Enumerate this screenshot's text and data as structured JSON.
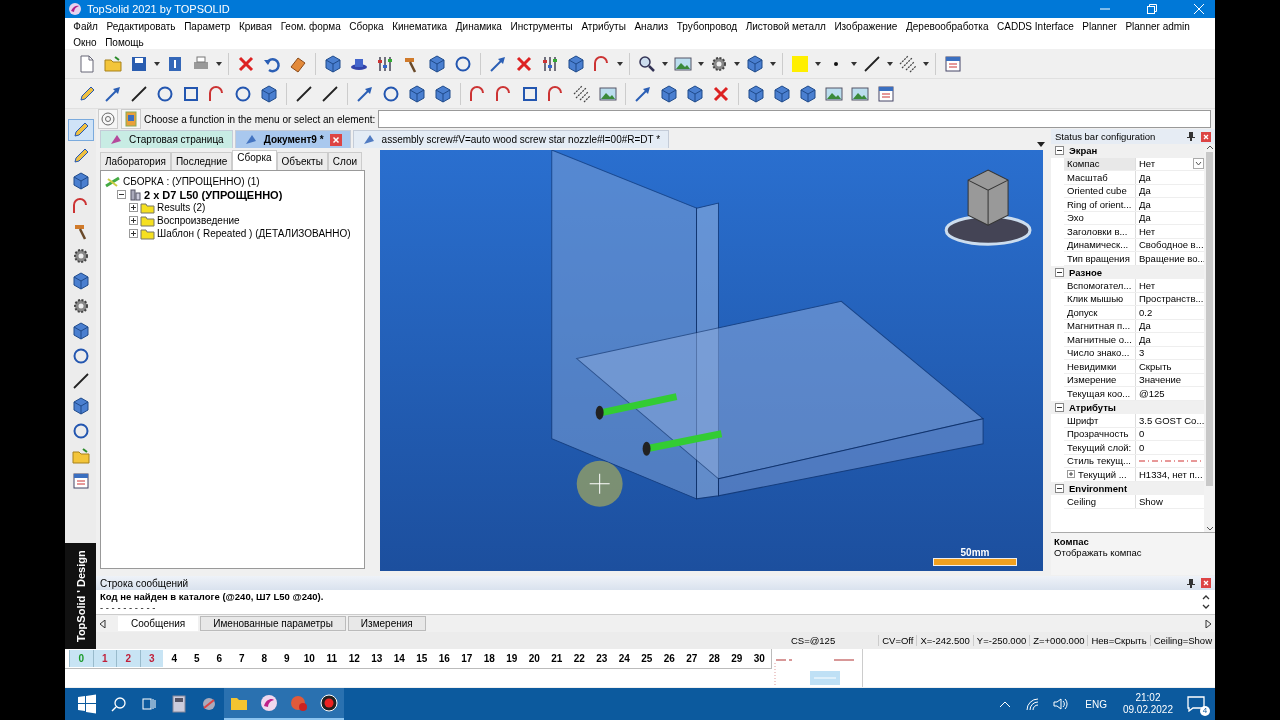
{
  "window": {
    "title": "TopSolid 2021 by TOPSOLID"
  },
  "menu": [
    "Файл",
    "Редактировать",
    "Параметр",
    "Кривая",
    "Геом. форма",
    "Сборка",
    "Кинематика",
    "Динамика",
    "Инструменты",
    "Атрибуты",
    "Анализ",
    "Трубопровод",
    "Листовой металл",
    "Изображение",
    "Деревообработка",
    "CADDS Interface",
    "Planner",
    "Planner admin",
    "Окно",
    "Помощь"
  ],
  "command": {
    "prompt": "Choose a function in the menu or select an element:"
  },
  "doc_tabs": [
    {
      "label": "Стартовая страница",
      "selected": false,
      "closable": false
    },
    {
      "label": "Документ9 *",
      "selected": true,
      "closable": true
    },
    {
      "label": "assembly screw#V=auto wood screw star nozzle#l=00#R=DT *",
      "selected": false,
      "closable": false
    }
  ],
  "panel_tabs": [
    {
      "label": "Лаборатория",
      "selected": false
    },
    {
      "label": "Последние",
      "selected": false
    },
    {
      "label": "Сборка",
      "selected": true
    },
    {
      "label": "Объекты",
      "selected": false
    },
    {
      "label": "Слои",
      "selected": false
    }
  ],
  "tree": [
    {
      "label": "СБОРКА : (УПРОЩЕННО) (1)",
      "bold": false,
      "children": [
        {
          "label": "2 x D7 L50 (УПРОЩЕННО)",
          "bold": true,
          "expanded": true,
          "children": [
            {
              "label": "Results (2)",
              "bold": false,
              "expanded": false
            },
            {
              "label": "Воспроизведение",
              "bold": false,
              "expanded": false
            },
            {
              "label": "Шаблон ( Repeated ) (ДЕТАЛИЗОВАННО)",
              "bold": false,
              "expanded": false
            }
          ]
        }
      ]
    }
  ],
  "viewport": {
    "scale_label": "50mm"
  },
  "properties": {
    "title": "Status bar configuration",
    "groups": [
      {
        "name": "Экран",
        "expanded": true,
        "rows": [
          {
            "kind": "text",
            "name": "Компас",
            "value": "Нет",
            "selected": true
          },
          {
            "kind": "text",
            "name": "Масштаб",
            "value": "Да",
            "selected": false
          },
          {
            "kind": "text",
            "name": "Oriented cube",
            "value": "Да",
            "selected": false
          },
          {
            "kind": "text",
            "name": "Ring of orient...",
            "value": "Да",
            "selected": false
          },
          {
            "kind": "text",
            "name": "Эхо",
            "value": "Да",
            "selected": false
          },
          {
            "kind": "text",
            "name": "Заголовки в...",
            "value": "Нет",
            "selected": false
          },
          {
            "kind": "text",
            "name": "Динамическ...",
            "value": "Свободное в...",
            "selected": false
          },
          {
            "kind": "text",
            "name": "Тип вращения",
            "value": "Вращение во...",
            "selected": false
          }
        ]
      },
      {
        "name": "Разное",
        "expanded": true,
        "rows": [
          {
            "kind": "text",
            "name": "Вспомогател...",
            "value": "Нет",
            "selected": false
          },
          {
            "kind": "text",
            "name": "Клик мышью",
            "value": "Пространств...",
            "selected": false
          },
          {
            "kind": "text",
            "name": "Допуск",
            "value": "0.2",
            "selected": false
          },
          {
            "kind": "text",
            "name": "Магнитная п...",
            "value": "Да",
            "selected": false
          },
          {
            "kind": "text",
            "name": "Магнитные о...",
            "value": "Да",
            "selected": false
          },
          {
            "kind": "text",
            "name": "Число знако...",
            "value": "3",
            "selected": false
          },
          {
            "kind": "text",
            "name": "Невидимки",
            "value": "Скрыть",
            "selected": false
          },
          {
            "kind": "text",
            "name": "Измерение",
            "value": "Значение",
            "selected": false
          },
          {
            "kind": "text",
            "name": "Текущая коо...",
            "value": "@125",
            "selected": false
          }
        ]
      },
      {
        "name": "Атрибуты",
        "expanded": true,
        "rows": [
          {
            "kind": "text",
            "name": "Шрифт",
            "value": "3.5  GOST Co...",
            "selected": false
          },
          {
            "kind": "text",
            "name": "Прозрачность",
            "value": "0",
            "selected": false
          },
          {
            "kind": "text",
            "name": "Текущий слой:",
            "value": "0",
            "selected": false
          },
          {
            "kind": "linestyle",
            "name": "Стиль текущ...",
            "selected": false
          },
          {
            "kind": "text",
            "name": "Текущий ...",
            "value": "H1334, нет п...",
            "selected": false,
            "expanded": false
          }
        ]
      },
      {
        "name": "Environment",
        "expanded": true,
        "rows": [
          {
            "kind": "text",
            "name": "Ceiling",
            "value": "Show",
            "selected": false
          }
        ]
      }
    ],
    "description": {
      "title": "Компас",
      "text": "Отображать компас"
    }
  },
  "messages": {
    "title": "Строка сообщений",
    "lines": [
      "Код не найден в каталоге (@240, Ш7 L50 @240).",
      "- - - - - - - - - -"
    ],
    "tabs": [
      {
        "label": "Сообщения",
        "selected": true
      },
      {
        "label": "Именованные параметры",
        "selected": false
      },
      {
        "label": "Измерения",
        "selected": false
      }
    ]
  },
  "status": [
    "CS=@125",
    "CV=Off",
    "X=-242.500",
    "Y=-250.000",
    "Z=+000.000",
    "Нев=Скрыть",
    "Ceiling=Show"
  ],
  "layers": [
    {
      "label": "0",
      "selected": true,
      "color": "#1a9a2a"
    },
    {
      "label": "1",
      "selected": true,
      "color": "#c0203a"
    },
    {
      "label": "2",
      "selected": true,
      "color": "#c0203a"
    },
    {
      "label": "3",
      "selected": true,
      "color": "#c0203a"
    },
    {
      "label": "4",
      "selected": false,
      "color": "#000000"
    },
    {
      "label": "5",
      "selected": false,
      "color": "#000000"
    },
    {
      "label": "6",
      "selected": false,
      "color": "#000000"
    },
    {
      "label": "7",
      "selected": false,
      "color": "#000000"
    },
    {
      "label": "8",
      "selected": false,
      "color": "#000000"
    },
    {
      "label": "9",
      "selected": false,
      "color": "#000000"
    },
    {
      "label": "10",
      "selected": false,
      "color": "#000000"
    },
    {
      "label": "11",
      "selected": false,
      "color": "#000000"
    },
    {
      "label": "12",
      "selected": false,
      "color": "#000000"
    },
    {
      "label": "13",
      "selected": false,
      "color": "#000000"
    },
    {
      "label": "14",
      "selected": false,
      "color": "#000000"
    },
    {
      "label": "15",
      "selected": false,
      "color": "#000000"
    },
    {
      "label": "16",
      "selected": false,
      "color": "#000000"
    },
    {
      "label": "17",
      "selected": false,
      "color": "#000000"
    },
    {
      "label": "18",
      "selected": false,
      "color": "#000000"
    },
    {
      "label": "19",
      "selected": false,
      "color": "#000000"
    },
    {
      "label": "20",
      "selected": false,
      "color": "#000000"
    },
    {
      "label": "21",
      "selected": false,
      "color": "#000000"
    },
    {
      "label": "22",
      "selected": false,
      "color": "#000000"
    },
    {
      "label": "23",
      "selected": false,
      "color": "#000000"
    },
    {
      "label": "24",
      "selected": false,
      "color": "#000000"
    },
    {
      "label": "25",
      "selected": false,
      "color": "#000000"
    },
    {
      "label": "26",
      "selected": false,
      "color": "#000000"
    },
    {
      "label": "27",
      "selected": false,
      "color": "#000000"
    },
    {
      "label": "28",
      "selected": false,
      "color": "#000000"
    },
    {
      "label": "29",
      "selected": false,
      "color": "#000000"
    },
    {
      "label": "30",
      "selected": false,
      "color": "#000000"
    }
  ],
  "side_label": "TopSolid ' Design",
  "taskbar": {
    "language": "ENG",
    "time": "21:02",
    "date": "09.02.2022",
    "notifications": "4"
  }
}
